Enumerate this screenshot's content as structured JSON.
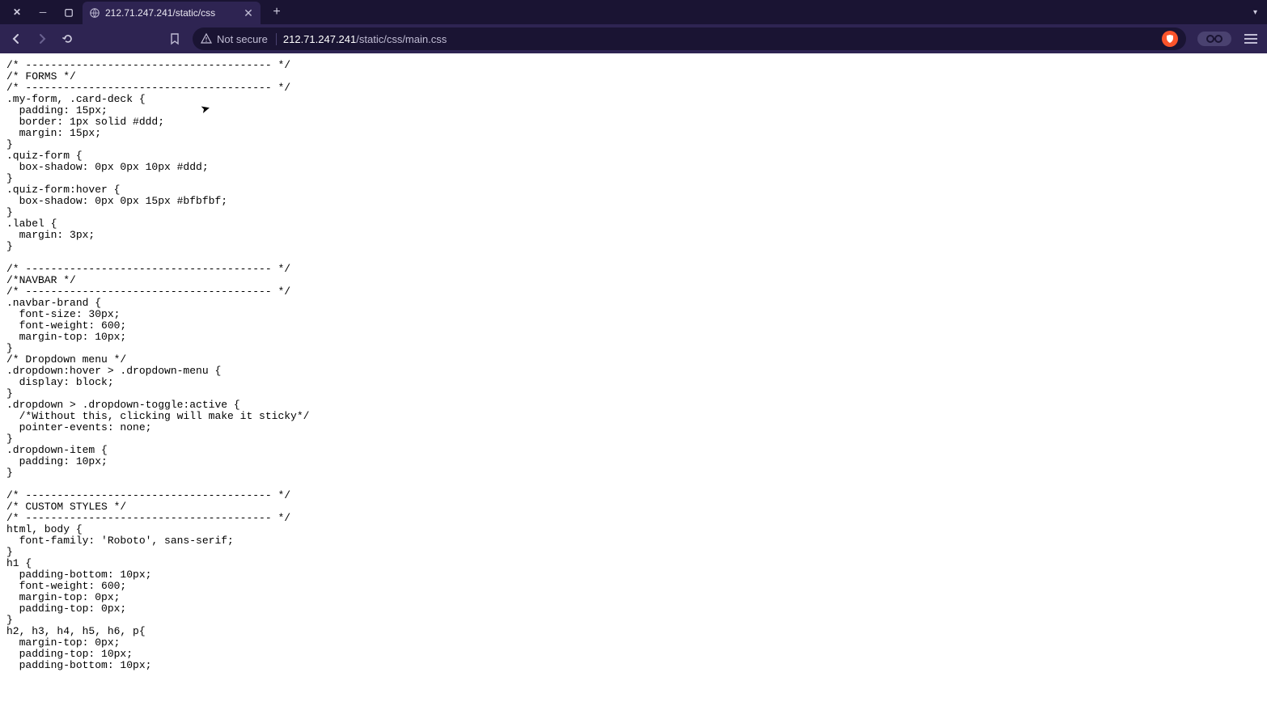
{
  "window": {
    "tab_title": "212.71.247.241/static/css",
    "menu_glyph": "▾"
  },
  "address": {
    "security_label": "Not secure",
    "url_host": "212.71.247.241",
    "url_path": "/static/css/main.css"
  },
  "content_text": "/* --------------------------------------- */\n/* FORMS */\n/* --------------------------------------- */\n.my-form, .card-deck {\n  padding: 15px;\n  border: 1px solid #ddd;\n  margin: 15px;\n}\n.quiz-form {\n  box-shadow: 0px 0px 10px #ddd;\n}\n.quiz-form:hover {\n  box-shadow: 0px 0px 15px #bfbfbf;\n}\n.label {\n  margin: 3px;\n}\n\n/* --------------------------------------- */\n/*NAVBAR */\n/* --------------------------------------- */\n.navbar-brand {\n  font-size: 30px;\n  font-weight: 600;\n  margin-top: 10px;\n}\n/* Dropdown menu */\n.dropdown:hover > .dropdown-menu {\n  display: block;\n}\n.dropdown > .dropdown-toggle:active {\n  /*Without this, clicking will make it sticky*/\n  pointer-events: none;\n}\n.dropdown-item {\n  padding: 10px;\n}\n\n/* --------------------------------------- */\n/* CUSTOM STYLES */\n/* --------------------------------------- */\nhtml, body {\n  font-family: 'Roboto', sans-serif;\n}\nh1 {\n  padding-bottom: 10px;\n  font-weight: 600;\n  margin-top: 0px;\n  padding-top: 0px;\n}\nh2, h3, h4, h5, h6, p{\n  margin-top: 0px;\n  padding-top: 10px;\n  padding-bottom: 10px;"
}
